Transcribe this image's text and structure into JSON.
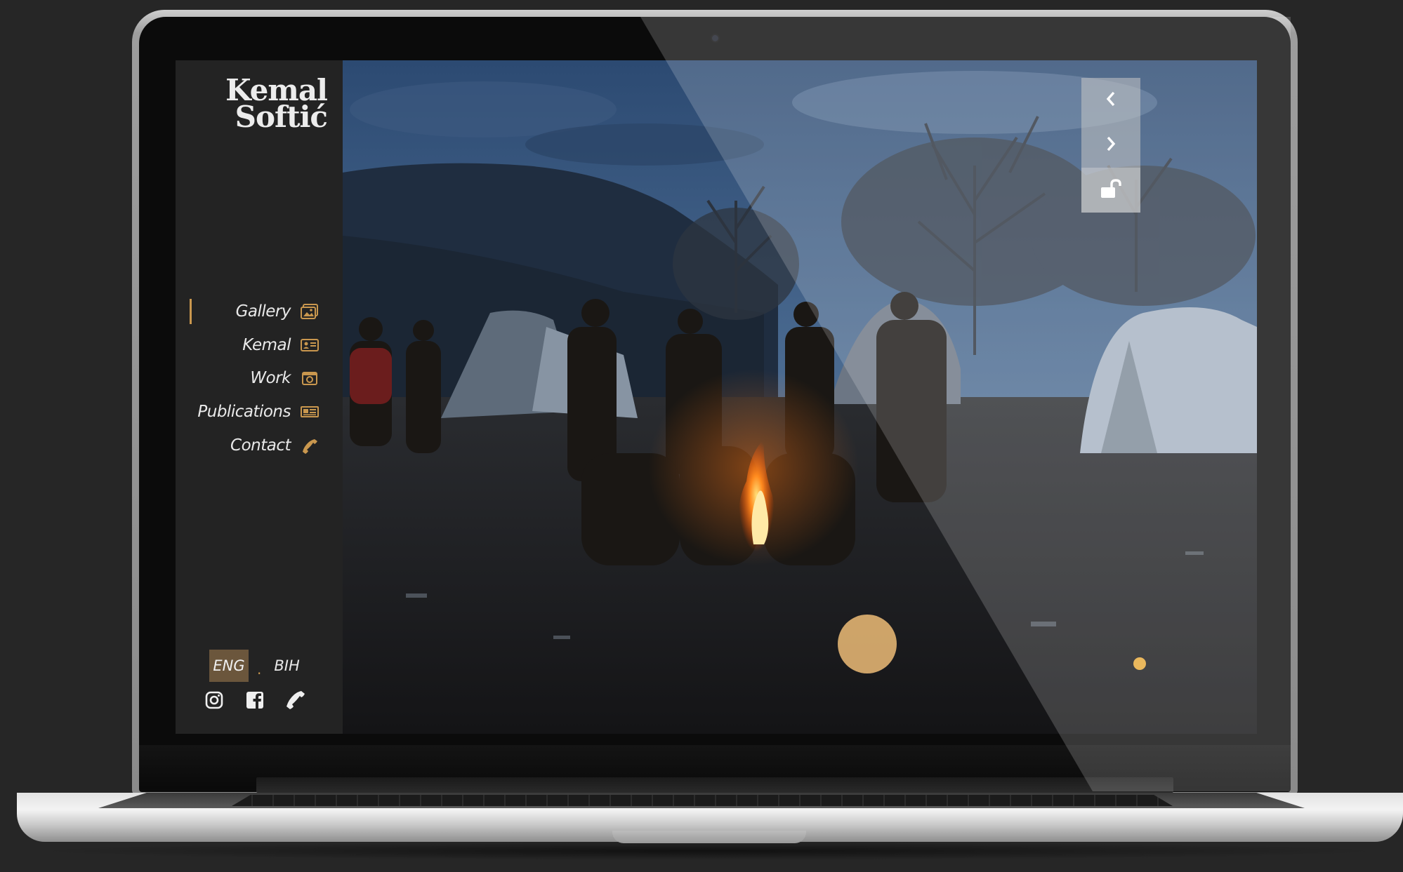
{
  "brand": {
    "line1": "Kemal",
    "line2": "Softić"
  },
  "nav": {
    "items": [
      {
        "label": "Gallery",
        "icon": "gallery-icon",
        "active": true
      },
      {
        "label": "Kemal",
        "icon": "id-card-icon",
        "active": false
      },
      {
        "label": "Work",
        "icon": "camera-icon",
        "active": false
      },
      {
        "label": "Publications",
        "icon": "newspaper-icon",
        "active": false
      },
      {
        "label": "Contact",
        "icon": "phone-icon",
        "active": false
      }
    ]
  },
  "language": {
    "eng": "ENG",
    "separator": ".",
    "bih": "BIH"
  },
  "social": [
    "instagram-icon",
    "facebook-icon",
    "phone-icon"
  ],
  "slider_controls": [
    "chevron-left-icon",
    "chevron-right-icon",
    "unlock-icon"
  ],
  "colors": {
    "accent": "#c9974e",
    "sidebar": "#232323",
    "button_dot": "#dcae6f"
  }
}
